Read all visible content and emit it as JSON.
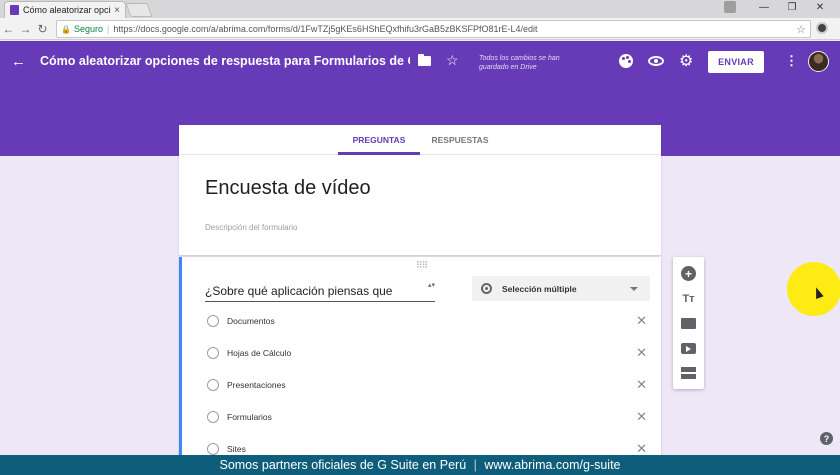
{
  "browser": {
    "tab_title": "Cómo aleatorizar opcio",
    "tab_close": "×",
    "secure_label": "Seguro",
    "url": "https://docs.google.com/a/abrima.com/forms/d/1FwTZj5gKEs6HShEQxfhifu3rGaB5zBKSFPfO81rE-L4/edit",
    "window_controls": [
      "—",
      "❐",
      "✕"
    ]
  },
  "header": {
    "back_icon": "←",
    "title": "Cómo aleatorizar opciones de respuesta para Formularios de Google",
    "star_icon": "☆",
    "saved_status": "Todos los cambios se han guardado en Drive",
    "settings_icon": "⚙",
    "send_label": "ENVIAR",
    "more_icon": "⋮",
    "accent_color": "#673ab7"
  },
  "tabs": {
    "questions": "PREGUNTAS",
    "responses": "RESPUESTAS"
  },
  "form": {
    "title": "Encuesta de vídeo",
    "description_placeholder": "Descripción del formulario"
  },
  "question": {
    "drag_handle": "⠿⠿",
    "title": "¿Sobre qué aplicación piensas que",
    "spinner": "▴▾",
    "type": "Selección múltiple",
    "remove_icon": "✕",
    "options": [
      "Documentos",
      "Hojas de Cálculo",
      "Presentaciones",
      "Formularios",
      "Sites"
    ]
  },
  "sidebar": {
    "add_icon": "+",
    "title_icon": "Tт"
  },
  "help_icon": "?",
  "banner": {
    "left": "Somos partners oficiales de G Suite en Perú",
    "divider": "|",
    "right": "www.abrima.com/g-suite"
  }
}
